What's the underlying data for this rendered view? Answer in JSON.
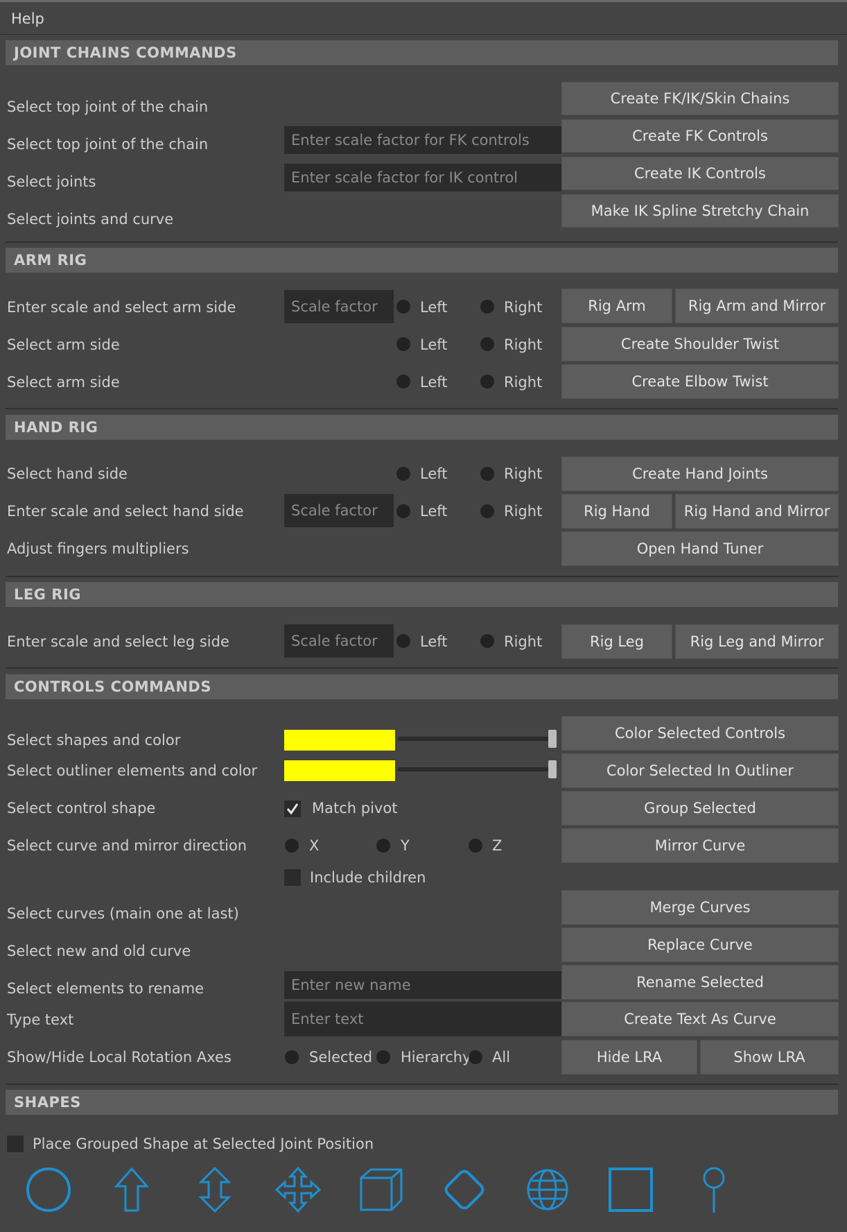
{
  "menubar": {
    "help": "Help"
  },
  "joint_chains": {
    "title": "JOINT CHAINS COMMANDS",
    "rows": [
      {
        "label": "Select top joint of the chain",
        "button": "Create FK/IK/Skin Chains"
      },
      {
        "label": "Select top joint of the chain",
        "placeholder": "Enter scale factor for FK controls",
        "button": "Create FK Controls"
      },
      {
        "label": "Select joints",
        "placeholder": "Enter scale factor for IK control",
        "button": "Create IK Controls"
      },
      {
        "label": "Select joints and curve",
        "button": "Make IK Spline Stretchy Chain"
      }
    ]
  },
  "arm_rig": {
    "title": "ARM RIG",
    "rows": [
      {
        "label": "Enter scale and select arm side",
        "placeholder": "Scale factor",
        "left": "Left",
        "right": "Right",
        "button1": "Rig Arm",
        "button2": "Rig Arm and Mirror"
      },
      {
        "label": "Select arm side",
        "left": "Left",
        "right": "Right",
        "button": "Create Shoulder Twist"
      },
      {
        "label": "Select arm side",
        "left": "Left",
        "right": "Right",
        "button": "Create Elbow Twist"
      }
    ]
  },
  "hand_rig": {
    "title": "HAND RIG",
    "rows": [
      {
        "label": "Select hand side",
        "left": "Left",
        "right": "Right",
        "button": "Create Hand Joints"
      },
      {
        "label": "Enter scale and select hand side",
        "placeholder": "Scale factor",
        "left": "Left",
        "right": "Right",
        "button1": "Rig Hand",
        "button2": "Rig Hand and Mirror"
      },
      {
        "label": "Adjust fingers multipliers",
        "button": "Open Hand Tuner"
      }
    ]
  },
  "leg_rig": {
    "title": "LEG RIG",
    "rows": [
      {
        "label": "Enter scale and select leg side",
        "placeholder": "Scale factor",
        "left": "Left",
        "right": "Right",
        "button1": "Rig Leg",
        "button2": "Rig Leg and Mirror"
      }
    ]
  },
  "controls": {
    "title": "CONTROLS COMMANDS",
    "color": "#ffff00",
    "rows": [
      {
        "label": "Select shapes and color",
        "button": "Color Selected Controls"
      },
      {
        "label": "Select outliner elements and color",
        "button": "Color Selected In Outliner"
      },
      {
        "label": "Select control shape",
        "check": "Match pivot",
        "button": "Group Selected"
      },
      {
        "label": "Select curve and mirror direction",
        "x": "X",
        "y": "Y",
        "z": "Z",
        "button": "Mirror Curve"
      },
      {
        "check": "Include children"
      },
      {
        "label": "Select curves (main one at last)",
        "button": "Merge Curves"
      },
      {
        "label": "Select new and old curve",
        "button": "Replace Curve"
      },
      {
        "label": "Select elements to rename",
        "placeholder": "Enter new name",
        "button": "Rename Selected"
      },
      {
        "label": "Type text",
        "placeholder": "Enter text",
        "button": "Create Text As Curve"
      },
      {
        "label": "Show/Hide Local Rotation Axes",
        "opt1": "Selected",
        "opt2": "Hierarchy",
        "opt3": "All",
        "button1": "Hide LRA",
        "button2": "Show LRA"
      }
    ]
  },
  "shapes": {
    "title": "SHAPES",
    "check": "Place Grouped Shape at Selected Joint Position",
    "icon_color": "#1e8fd0",
    "icons": [
      "circle-icon",
      "arrow-up-icon",
      "double-arrow-icon",
      "four-arrows-icon",
      "cube-icon",
      "diamond-icon",
      "sphere-icon",
      "square-icon",
      "pin-icon"
    ]
  }
}
